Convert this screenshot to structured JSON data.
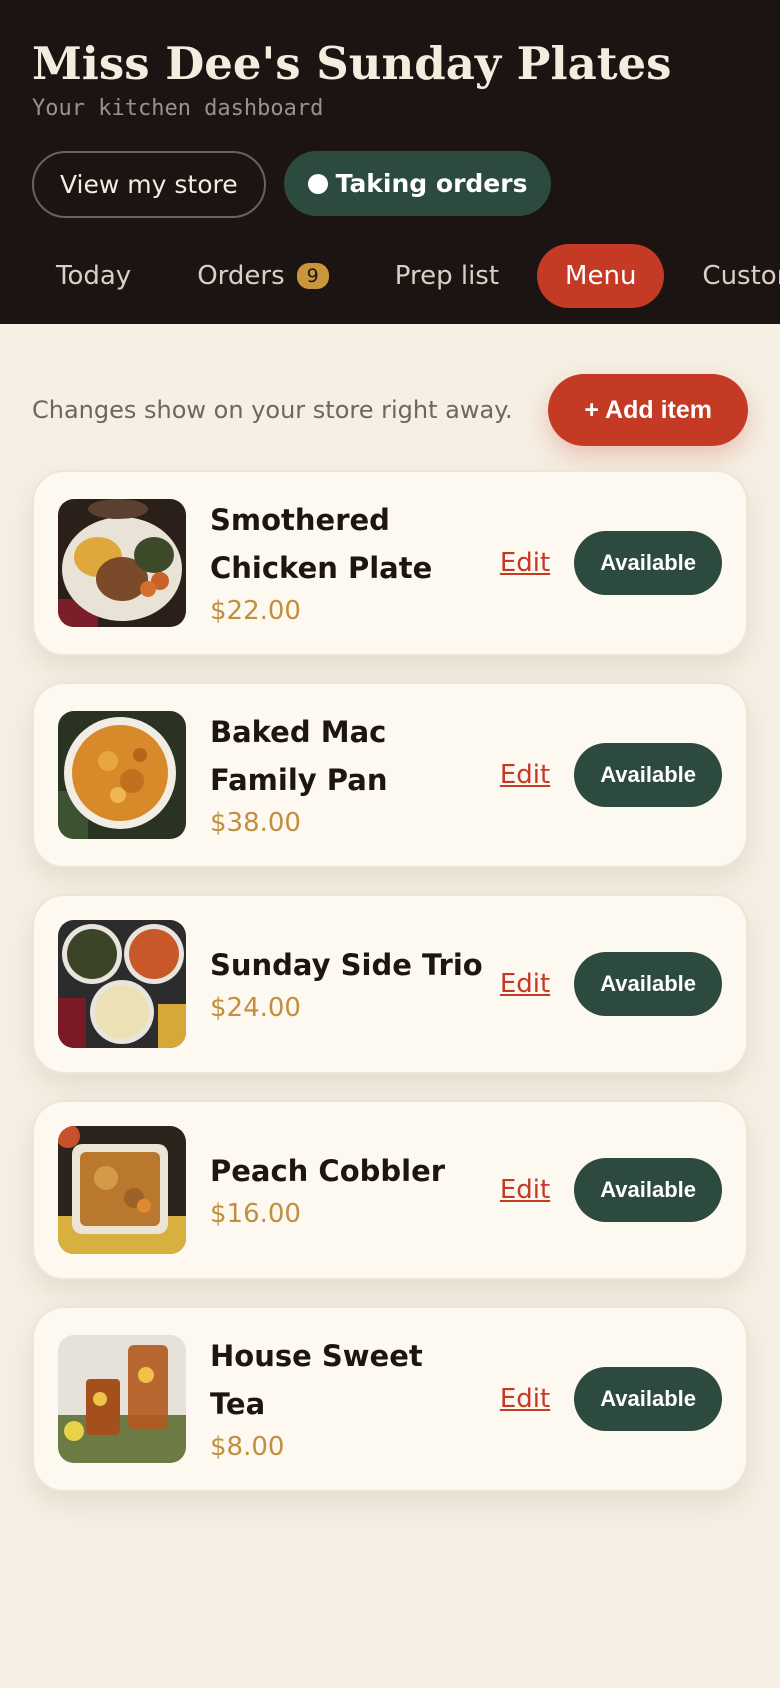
{
  "header": {
    "title": "Miss Dee's Sunday Plates",
    "subtitle": "Your kitchen dashboard",
    "view_store_label": "View my store",
    "status_label": "Taking orders"
  },
  "tabs": [
    {
      "label": "Today"
    },
    {
      "label": "Orders",
      "badge": "9"
    },
    {
      "label": "Prep list"
    },
    {
      "label": "Menu",
      "active": true
    },
    {
      "label": "Customers"
    }
  ],
  "toolbar": {
    "hint": "Changes show on your store right away.",
    "add_label": "+ Add item"
  },
  "items": [
    {
      "name": "Smothered Chicken Plate",
      "price": "$22.00",
      "edit_label": "Edit",
      "status_label": "Available",
      "icon": "chicken-plate-photo"
    },
    {
      "name": "Baked Mac Family Pan",
      "price": "$38.00",
      "edit_label": "Edit",
      "status_label": "Available",
      "icon": "mac-pan-photo"
    },
    {
      "name": "Sunday Side Trio",
      "price": "$24.00",
      "edit_label": "Edit",
      "status_label": "Available",
      "icon": "side-trio-photo"
    },
    {
      "name": "Peach Cobbler",
      "price": "$16.00",
      "edit_label": "Edit",
      "status_label": "Available",
      "icon": "cobbler-photo"
    },
    {
      "name": "House Sweet Tea",
      "price": "$8.00",
      "edit_label": "Edit",
      "status_label": "Available",
      "icon": "sweet-tea-photo"
    }
  ],
  "colors": {
    "header_bg": "#1c1412",
    "accent_red": "#c43a24",
    "accent_green": "#2d4a3e",
    "price_gold": "#c0903e",
    "page_bg": "#f6efe3"
  }
}
